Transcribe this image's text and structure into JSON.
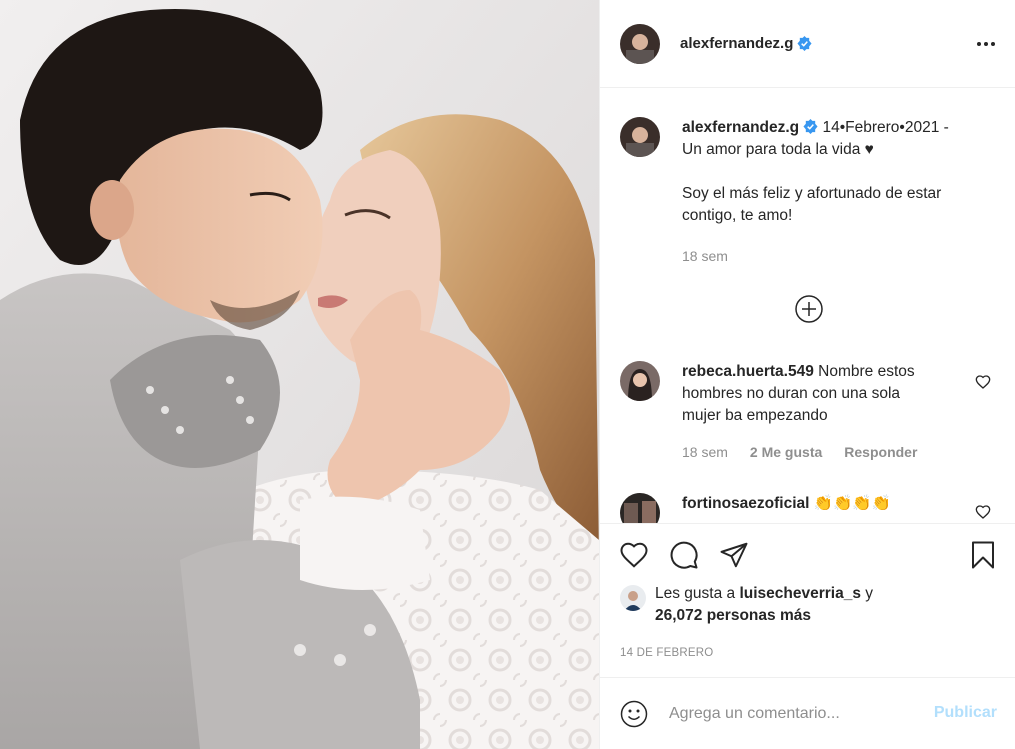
{
  "post": {
    "username": "alexfernandez.g",
    "more_icon": "more-horizontal-icon",
    "verified_icon": "verified-badge-icon"
  },
  "caption": {
    "username": "alexfernandez.g",
    "line1": "14•Febrero•2021 -",
    "line2": "Un amor para toda la vida ♥",
    "line3": "Soy el más feliz y afortunado de estar",
    "line4": "contigo, te amo!",
    "time": "18 sem"
  },
  "load_more_icon": "plus-circle-icon",
  "comments": [
    {
      "username": "rebeca.huerta.549",
      "text_first": "Nombre estos",
      "text_second": "hombres no duran con una sola",
      "text_third": "mujer ba empezando",
      "time": "18 sem",
      "likes": "2 Me gusta",
      "reply": "Responder"
    },
    {
      "username": "fortinosaezoficial",
      "text": "👏👏👏👏"
    }
  ],
  "actions": {
    "like_icon": "heart-icon",
    "comment_icon": "comment-icon",
    "share_icon": "paper-plane-icon",
    "save_icon": "bookmark-icon"
  },
  "likes": {
    "prefix": "Les gusta a",
    "user": "luisecheverria_s",
    "suffix": "y",
    "others": "26,072 personas más"
  },
  "date": "14 DE FEBRERO",
  "add_comment": {
    "placeholder": "Agrega un comentario...",
    "publish_label": "Publicar",
    "emoji_icon": "smiley-icon"
  },
  "colors": {
    "verified": "#3897f0",
    "publish_disabled": "#b2dffc",
    "muted": "#8e8e8e",
    "text": "#262626"
  }
}
